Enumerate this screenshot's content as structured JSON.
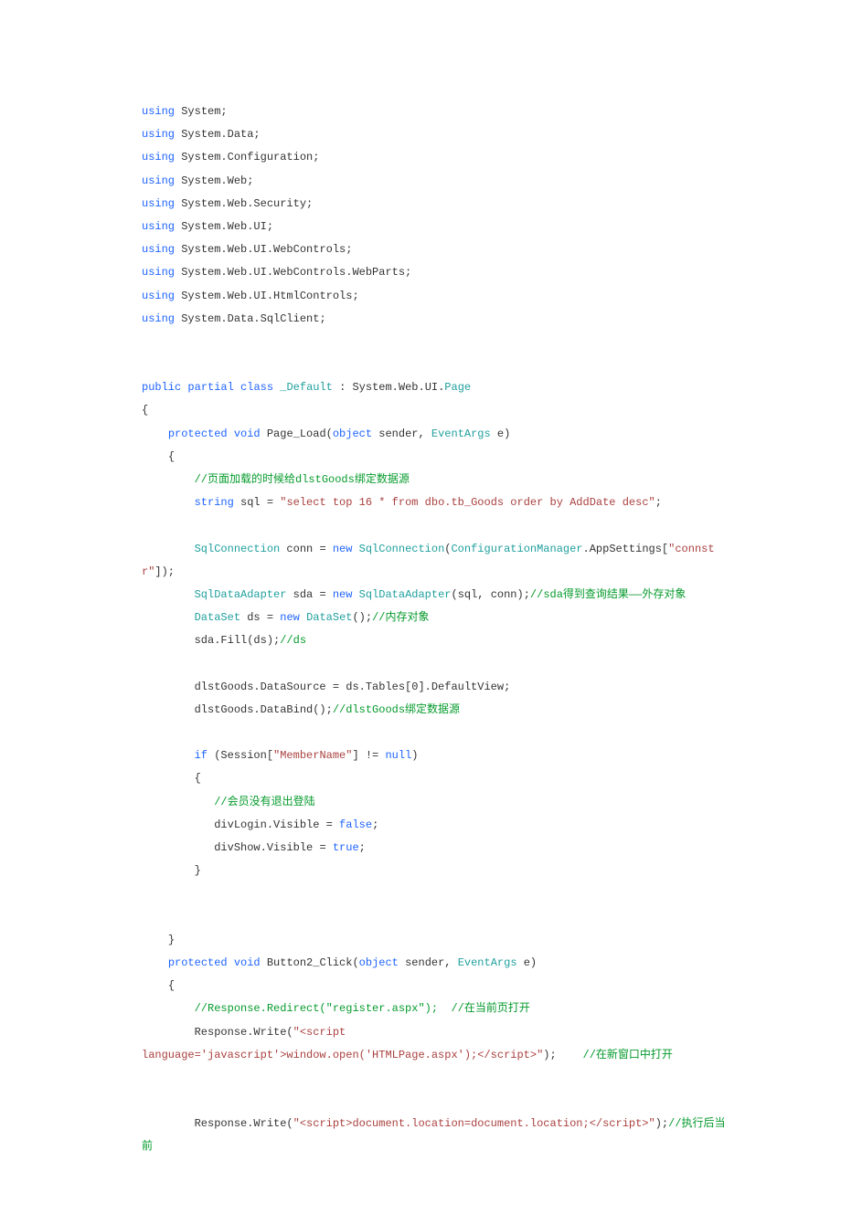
{
  "code": {
    "usings": [
      "using System;",
      "using System.Data;",
      "using System.Configuration;",
      "using System.Web;",
      "using System.Web.Security;",
      "using System.Web.UI;",
      "using System.Web.UI.WebControls;",
      "using System.Web.UI.WebControls.WebParts;",
      "using System.Web.UI.HtmlControls;",
      "using System.Data.SqlClient;"
    ],
    "class_decl": "public partial class _Default : System.Web.UI.Page",
    "page_load_sig": "    protected void Page_Load(object sender, EventArgs e)",
    "comment_bind": "        //页面加载的时候给dlstGoods绑定数据源",
    "sql_line_a": "        string sql = ",
    "sql_line_b": "\"select top 16 * from dbo.tb_Goods order by AddDate desc\"",
    "conn_a": "        SqlConnection conn = new SqlConnection(ConfigurationManager.AppSettings[",
    "conn_b": "\"connstr\"",
    "conn_c": "]);",
    "sda_a": "        SqlDataAdapter sda = new SqlDataAdapter(sql, conn);",
    "sda_b": "//sda得到查询结果——外存对象",
    "ds_a": "        DataSet ds = new DataSet();",
    "ds_b": "//内存对象",
    "fill_a": "        sda.Fill(ds);",
    "fill_b": "//ds",
    "dsrc": "        dlstGoods.DataSource = ds.Tables[0].DefaultView;",
    "dbind_a": "        dlstGoods.DataBind();",
    "dbind_b": "//dlstGoods绑定数据源",
    "if_a": "        if (Session[",
    "if_b": "\"MemberName\"",
    "if_c": "] != null)",
    "if_open": "        {",
    "cmt_member": "           //会员没有退出登陆",
    "divlogin": "           divLogin.Visible = false;",
    "divshow": "           divShow.Visible = true;",
    "if_close": "        }",
    "pl_close": "    }",
    "btn2_sig": "    protected void Button2_Click(object sender, EventArgs e)",
    "btn2_open": "    {",
    "cmt_redir": "        //Response.Redirect(\"register.aspx\");  //在当前页打开",
    "rw1_a": "        Response.Write(",
    "rw1_b": "\"<script",
    "rw2_a": "language='javascript'>window.open('HTMLPage.aspx');</script>\"",
    "rw2_b": ");    ",
    "rw2_c": "//在新窗口中打开",
    "rw3_a": "        Response.Write(",
    "rw3_b": "\"<script>document.location=document.location;</script>\"",
    "rw3_c": ");",
    "rw3_d": "//执行后当前"
  }
}
